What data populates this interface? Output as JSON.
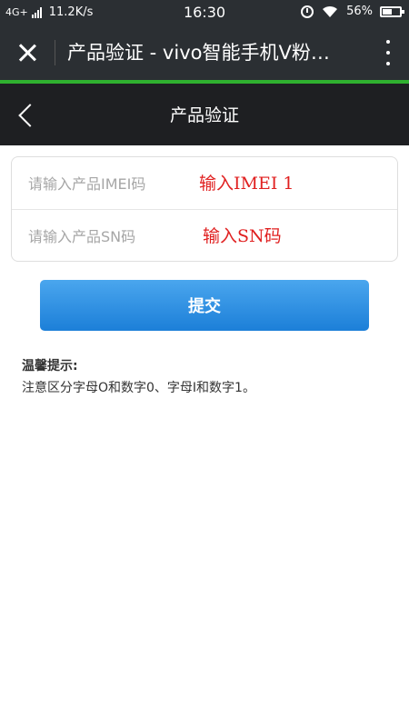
{
  "status_bar": {
    "network_type": "4G+",
    "speed": "11.2K/s",
    "time": "16:30",
    "battery": "56%",
    "battery_level": 0.56,
    "icons": [
      "signal-icon",
      "alarm-icon",
      "wifi-icon",
      "battery-icon"
    ]
  },
  "wechat_bar": {
    "title": "产品验证 - vivo智能手机V粉…",
    "close_icon": "close-icon",
    "more_icon": "more-icon",
    "progress_green": "#2fb02f",
    "progress": 1.0
  },
  "page": {
    "title": "产品验证",
    "back_icon": "chevron-left-icon"
  },
  "form": {
    "imei_placeholder": "请输入产品IMEI码",
    "imei_value": "",
    "imei_annotation": "输入IMEI 1",
    "sn_placeholder": "请输入产品SN码",
    "sn_value": "",
    "sn_annotation": "输入SN码",
    "annotation_color": "#e02020"
  },
  "submit": {
    "label": "提交",
    "color": "#2a8de4"
  },
  "tips": {
    "title": "温馨提示:",
    "text": "注意区分字母O和数字0、字母I和数字1。"
  }
}
